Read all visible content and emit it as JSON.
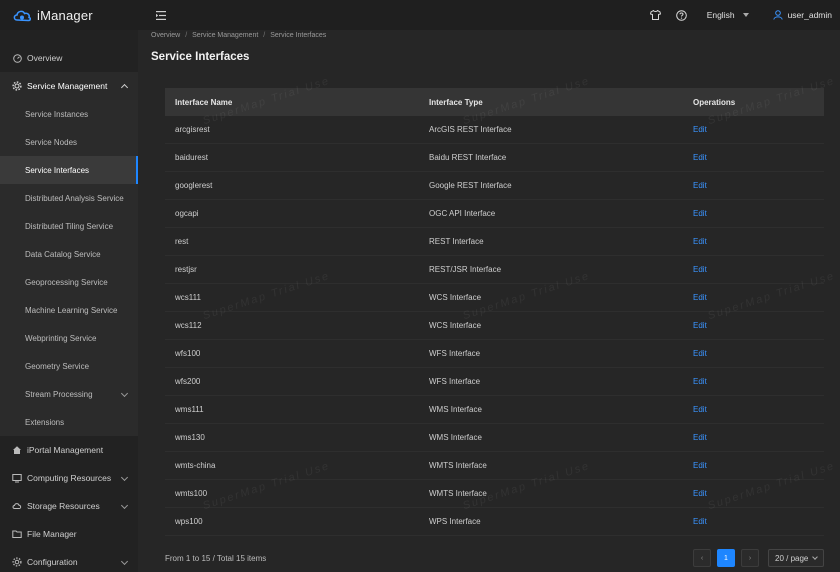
{
  "app": {
    "title": "iManager"
  },
  "topbar": {
    "language": "English",
    "user": "user_admin"
  },
  "sidebar": {
    "items": [
      {
        "label": "Overview"
      },
      {
        "label": "Service Management"
      },
      {
        "label": "iPortal Management"
      },
      {
        "label": "Computing Resources"
      },
      {
        "label": "Storage Resources"
      },
      {
        "label": "File Manager"
      },
      {
        "label": "Configuration"
      }
    ],
    "sub_items": [
      {
        "label": "Service Instances"
      },
      {
        "label": "Service Nodes"
      },
      {
        "label": "Service Interfaces"
      },
      {
        "label": "Distributed Analysis Service"
      },
      {
        "label": "Distributed Tiling Service"
      },
      {
        "label": "Data Catalog Service"
      },
      {
        "label": "Geoprocessing Service"
      },
      {
        "label": "Machine Learning Service"
      },
      {
        "label": "Webprinting Service"
      },
      {
        "label": "Geometry Service"
      },
      {
        "label": "Stream Processing"
      },
      {
        "label": "Extensions"
      }
    ]
  },
  "breadcrumb": [
    "Overview",
    "Service Management",
    "Service Interfaces"
  ],
  "page": {
    "title": "Service Interfaces"
  },
  "table": {
    "headers": [
      "Interface Name",
      "Interface Type",
      "Operations"
    ],
    "rows": [
      {
        "name": "arcgisrest",
        "type": "ArcGIS REST Interface",
        "op": "Edit"
      },
      {
        "name": "baidurest",
        "type": "Baidu REST Interface",
        "op": "Edit"
      },
      {
        "name": "googlerest",
        "type": "Google REST Interface",
        "op": "Edit"
      },
      {
        "name": "ogcapi",
        "type": "OGC API Interface",
        "op": "Edit"
      },
      {
        "name": "rest",
        "type": "REST Interface",
        "op": "Edit"
      },
      {
        "name": "restjsr",
        "type": "REST/JSR Interface",
        "op": "Edit"
      },
      {
        "name": "wcs111",
        "type": "WCS Interface",
        "op": "Edit"
      },
      {
        "name": "wcs112",
        "type": "WCS Interface",
        "op": "Edit"
      },
      {
        "name": "wfs100",
        "type": "WFS Interface",
        "op": "Edit"
      },
      {
        "name": "wfs200",
        "type": "WFS Interface",
        "op": "Edit"
      },
      {
        "name": "wms111",
        "type": "WMS Interface",
        "op": "Edit"
      },
      {
        "name": "wms130",
        "type": "WMS Interface",
        "op": "Edit"
      },
      {
        "name": "wmts-china",
        "type": "WMTS Interface",
        "op": "Edit"
      },
      {
        "name": "wmts100",
        "type": "WMTS Interface",
        "op": "Edit"
      },
      {
        "name": "wps100",
        "type": "WPS Interface",
        "op": "Edit"
      }
    ]
  },
  "footer": {
    "total": "From 1 to 15 / Total 15 items",
    "current_page": "1",
    "page_size": "20 / page"
  },
  "watermark": "SuperMap Trial Use",
  "colors": {
    "accent": "#1e86ff",
    "link": "#3a94ff",
    "bg": "#262626"
  }
}
